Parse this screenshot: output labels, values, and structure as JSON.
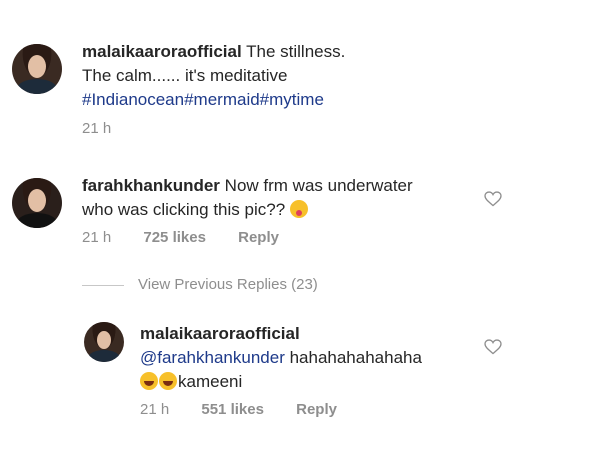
{
  "post_caption": {
    "username": "malaikaaroraofficial",
    "line1": "The stillness.",
    "line2": "The calm...... it's meditative",
    "hashtags": "#Indianocean#mermaid#mytime",
    "time": "21 h"
  },
  "comment": {
    "username": "farahkhankunder",
    "line1": "Now frm was underwater",
    "line2": "who was clicking this pic??",
    "time": "21 h",
    "likes": "725 likes",
    "reply": "Reply"
  },
  "view_previous": {
    "label": "View Previous Replies (23)"
  },
  "reply_comment": {
    "username": "malaikaaroraofficial",
    "mention": "@farahkhankunder",
    "line1_rest": " hahahahahahaha",
    "line2_text": "kameeni",
    "time": "21 h",
    "likes": "551 likes",
    "reply": "Reply"
  },
  "icons": {
    "heart": "heart-outline-icon",
    "emoji_tongue": "face-with-tongue-emoji",
    "emoji_laugh": "tears-of-joy-emoji"
  }
}
